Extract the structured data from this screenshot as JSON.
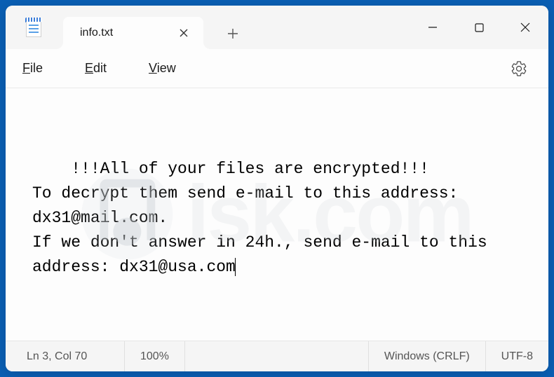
{
  "tab": {
    "title": "info.txt"
  },
  "menubar": {
    "file": "File",
    "edit": "Edit",
    "view": "View"
  },
  "content": {
    "text": "!!!All of your files are encrypted!!!\nTo decrypt them send e-mail to this address: dx31@mail.com.\nIf we don't answer in 24h., send e-mail to this address: dx31@usa.com"
  },
  "statusbar": {
    "position": "Ln 3, Col 70",
    "zoom": "100%",
    "line_ending": "Windows (CRLF)",
    "encoding": "UTF-8"
  },
  "watermark": {
    "text": "isk.com"
  }
}
